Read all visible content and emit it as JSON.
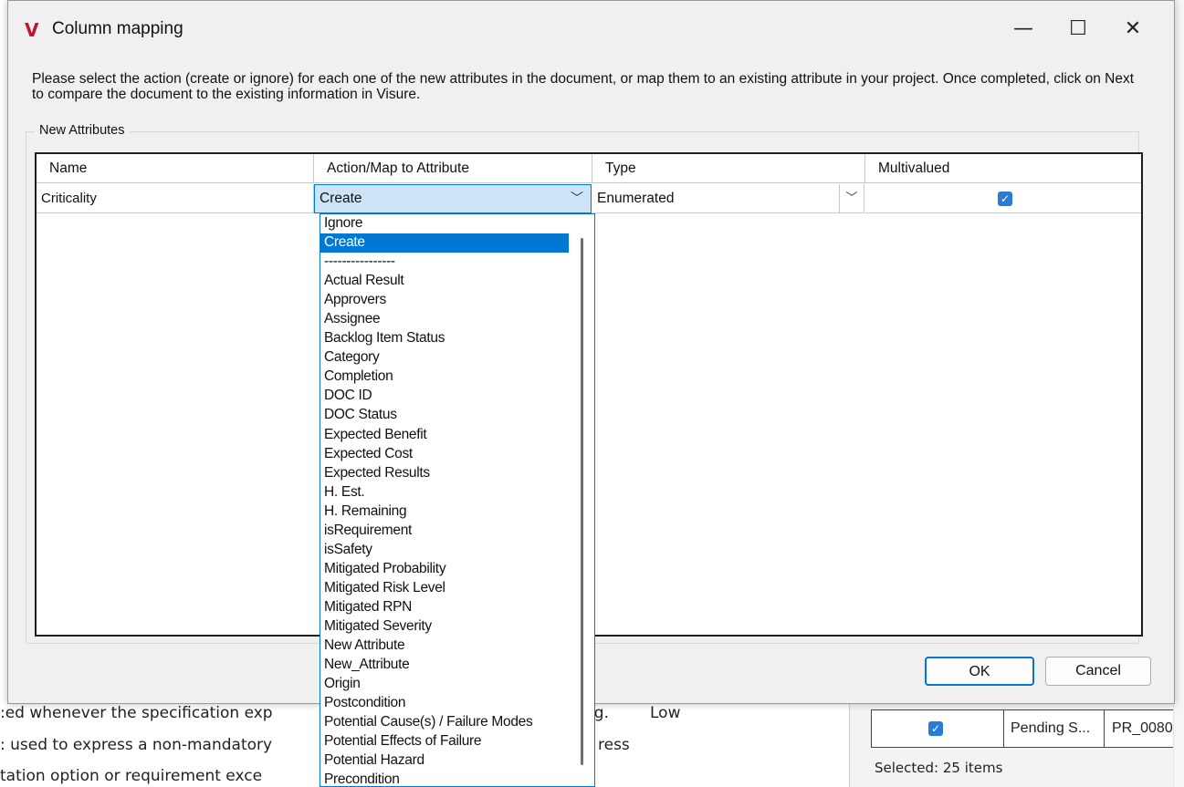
{
  "window": {
    "title": "Column mapping",
    "logo": "V",
    "minimize_glyph": "—",
    "maximize_glyph": "☐",
    "close_glyph": "✕"
  },
  "instructions": "Please select the action (create or ignore) for each one of the new attributes in the document, or map them to an existing attribute in your project. Once completed, click on Next to compare the document to the existing information in Visure.",
  "group_label": "New Attributes",
  "columns": [
    "Name",
    "Action/Map to Attribute",
    "Type",
    "Multivalued"
  ],
  "row": {
    "name": "Criticality",
    "action": "Create",
    "type": "Enumerated",
    "multivalued": true
  },
  "dropdown": {
    "selected": "Create",
    "options": [
      "Ignore",
      "Create",
      "----------------",
      "Actual Result",
      "Approvers",
      "Assignee",
      "Backlog Item Status",
      "Category",
      "Completion",
      "DOC ID",
      "DOC Status",
      "Expected Benefit",
      "Expected Cost",
      "Expected Results",
      "H. Est.",
      "H. Remaining",
      "isRequirement",
      "isSafety",
      "Mitigated Probability",
      "Mitigated Risk Level",
      "Mitigated RPN",
      "Mitigated Severity",
      "New Attribute",
      "New_Attribute",
      "Origin",
      "Postcondition",
      "Potential Cause(s) / Failure Modes",
      "Potential Effects of Failure",
      "Potential Hazard",
      "Precondition"
    ]
  },
  "buttons": {
    "ok": "OK",
    "cancel": "Cancel"
  },
  "background": {
    "lines": [
      ":ed whenever the specification exp",
      ": used to express a non-mandatory",
      "tation option or requirement exce"
    ],
    "fragments": [
      "ng.",
      "Low",
      "ress"
    ],
    "right_table": {
      "status": "Pending S...",
      "id": "PR_0080"
    },
    "selected_text": "Selected: 25 items"
  },
  "icons": {
    "dropdown_arrow": "chevron-down-icon",
    "checkbox": "checkmark-icon"
  },
  "colors": {
    "accent": "#0078d4",
    "logo": "#c0162d",
    "combo_selected_bg": "#cce4f7",
    "checkbox": "#2a7bd4"
  }
}
